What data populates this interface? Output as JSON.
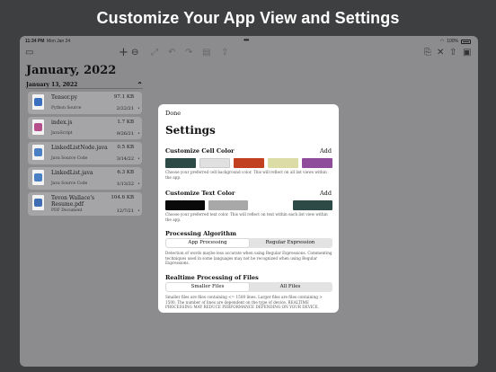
{
  "headline": "Customize Your App View and Settings",
  "status": {
    "time": "11:34 PM",
    "date": "Mon Jan 24",
    "battery": "100%"
  },
  "sidebar": {
    "title": "January, 2022",
    "section": "January 13, 2022",
    "files": [
      {
        "name": "Tensor.py",
        "type": "Python Source",
        "size": "97.1 KB",
        "date": "2/22/21",
        "icon_color": "#3a6fbf"
      },
      {
        "name": "index.js",
        "type": "JavaScript",
        "size": "1.7 KB",
        "date": "9/26/21",
        "icon_color": "#b54f8c"
      },
      {
        "name": "LinkedListNode.java",
        "type": "Java Source Code",
        "size": "0.5 KB",
        "date": "3/14/22",
        "icon_color": "#4a7fc4"
      },
      {
        "name": "LinkedList.java",
        "type": "Java Source Code",
        "size": "6.3 KB",
        "date": "1/13/22",
        "icon_color": "#4a7fc4"
      },
      {
        "name": "Tevon Wallace's Resume.pdf",
        "type": "PDF Document",
        "size": "104.6 KB",
        "date": "12/7/21",
        "icon_color": "#3e6db3"
      }
    ]
  },
  "modal": {
    "done": "Done",
    "title": "Settings",
    "cell_color": {
      "label": "Customize Cell Color",
      "add": "Add",
      "swatches": [
        "#2e4a46",
        "#e0e0e0",
        "#c2401f",
        "#dcdca6",
        "#8f4c9a"
      ],
      "help": "Choose your preferred cell background color. This will reflect on all list views within the app."
    },
    "text_color": {
      "label": "Customize Text Color",
      "add": "Add",
      "swatches": [
        "#0a0a0a",
        "#a8a8a8",
        "#2e4a46"
      ],
      "help": "Choose your preferred text color. This will reflect on text within each list view within the app."
    },
    "algorithm": {
      "label": "Processing Algorithm",
      "options": [
        "App Processing",
        "Regular Expression"
      ],
      "selected": "App Processing",
      "help": "Detection of words maybe less accurate when using Regular Expressions. Commenting techniques used in some languages may not be recognized when using Regular Expressions."
    },
    "realtime": {
      "label": "Realtime Processing of Files",
      "options": [
        "Smaller Files",
        "All Files"
      ],
      "selected": "Smaller Files",
      "help": "Smaller files are files containing <= 1500 lines. Larger files are files containing > 1500. The number of lines are dependent on the type of device. REALTIME PROCESSING MAY REDUCE PERFORMANCE DEPENDING ON YOUR DEVICE."
    }
  }
}
